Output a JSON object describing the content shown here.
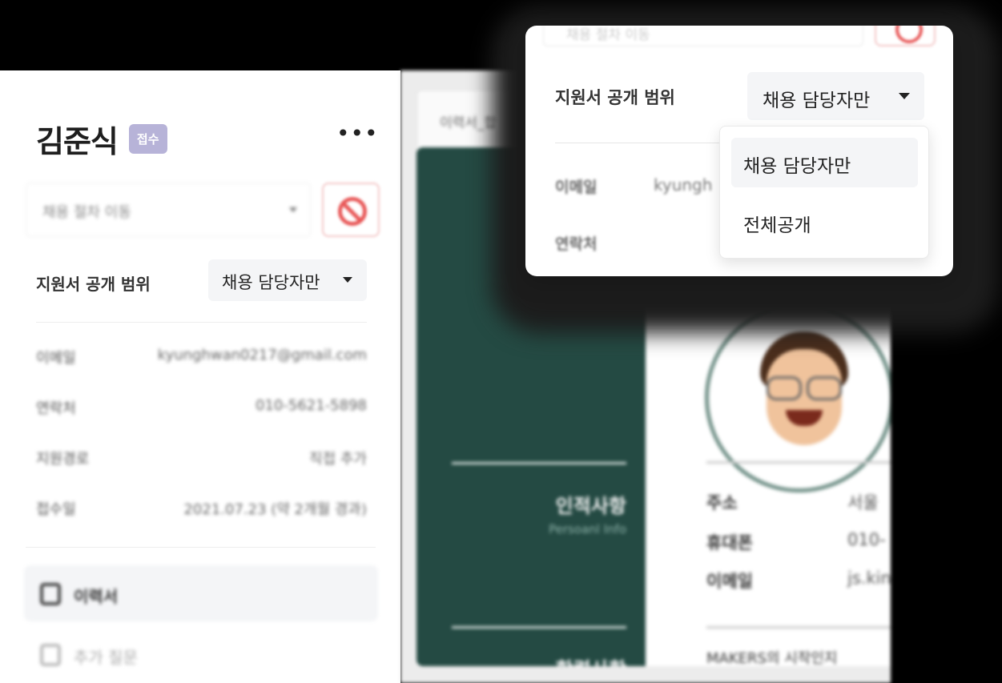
{
  "applicant": {
    "name": "김준식",
    "status": "접수",
    "more_label": "•••"
  },
  "stage_move": {
    "placeholder": "채용 절차 이동"
  },
  "visibility": {
    "label": "지원서 공개 범위",
    "selected": "채용 담당자만",
    "options": [
      "채용 담당자만",
      "전체공개"
    ]
  },
  "info": [
    {
      "key": "이메일",
      "value": "kyunghwan0217@gmail.com"
    },
    {
      "key": "연락처",
      "value": "010-5621-5898"
    },
    {
      "key": "지원경로",
      "value": "직접 추가"
    },
    {
      "key": "접수일",
      "value": "2021.07.23 (약 2개월 경과)"
    }
  ],
  "menu": [
    {
      "label": "이력서",
      "active": true
    },
    {
      "label": "추가 질문",
      "active": false
    }
  ],
  "resume": {
    "tab_label": "이력서_합",
    "section1_title": "인적사항",
    "section1_sub": "Persoanl Info",
    "section2_title": "학력사항",
    "fields": [
      {
        "key": "주소",
        "value": "서울"
      },
      {
        "key": "휴대폰",
        "value": "010-"
      },
      {
        "key": "이메일",
        "value": "js.kin"
      }
    ],
    "footer_text": "MAKERS의 시작인지"
  },
  "popup": {
    "top_field_text": "채용 절차 이동",
    "email_label": "이메일",
    "email_value": "kyungh",
    "phone_label": "연락처"
  },
  "colors": {
    "badge": "#b7b3d8",
    "resume_sidebar": "#244a43",
    "danger": "#e85858"
  }
}
